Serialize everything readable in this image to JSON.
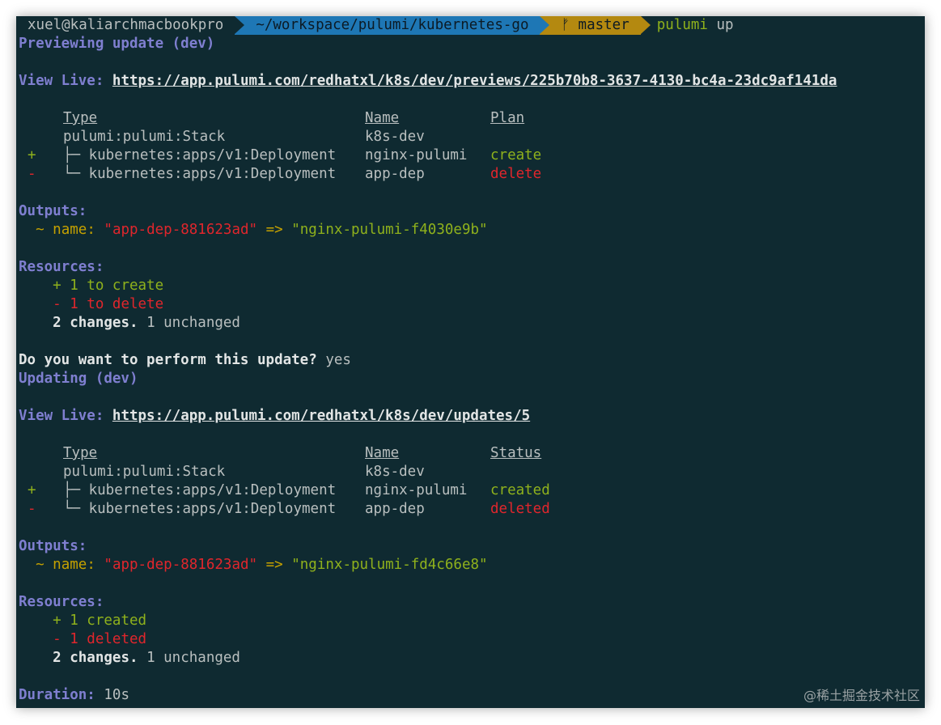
{
  "prompt": {
    "user": "xuel@kaliarchmacbookpro",
    "path": "~/workspace/pulumi/kubernetes-go",
    "branch_icon": "git-branch-icon",
    "branch_glyph": "ᚠ",
    "branch": "master",
    "command": "pulumi",
    "command_arg": "up"
  },
  "preview": {
    "title": "Previewing update (dev)",
    "view_live_label": "View Live:",
    "view_live_url": "https://app.pulumi.com/redhatxl/k8s/dev/previews/225b70b8-3637-4130-bc4a-23dc9af141da",
    "headers": {
      "type": "Type",
      "name": "Name",
      "plan": "Plan"
    },
    "rows": [
      {
        "op": "",
        "type": "pulumi:pulumi:Stack",
        "name": "k8s-dev",
        "plan": ""
      },
      {
        "op": "+",
        "type": "├─ kubernetes:apps/v1:Deployment",
        "name": "nginx-pulumi",
        "plan": "create"
      },
      {
        "op": "-",
        "type": "└─ kubernetes:apps/v1:Deployment",
        "name": "app-dep",
        "plan": "delete"
      }
    ],
    "outputs_label": "Outputs:",
    "output_tilde": "~",
    "output_key": "name:",
    "output_old": "\"app-dep-881623ad\"",
    "output_arrow": "=>",
    "output_new": "\"nginx-pulumi-f4030e9b\"",
    "resources_label": "Resources:",
    "res_create": "+ 1 to create",
    "res_delete": "- 1 to delete",
    "changes_bold": "2 changes.",
    "changes_rest": "1 unchanged"
  },
  "confirm": {
    "question": "Do you want to perform this update?",
    "answer": "yes"
  },
  "update": {
    "title": "Updating (dev)",
    "view_live_label": "View Live:",
    "view_live_url": "https://app.pulumi.com/redhatxl/k8s/dev/updates/5",
    "headers": {
      "type": "Type",
      "name": "Name",
      "status": "Status"
    },
    "rows": [
      {
        "op": "",
        "type": "pulumi:pulumi:Stack",
        "name": "k8s-dev",
        "status": ""
      },
      {
        "op": "+",
        "type": "├─ kubernetes:apps/v1:Deployment",
        "name": "nginx-pulumi",
        "status": "created"
      },
      {
        "op": "-",
        "type": "└─ kubernetes:apps/v1:Deployment",
        "name": "app-dep",
        "status": "deleted"
      }
    ],
    "outputs_label": "Outputs:",
    "output_tilde": "~",
    "output_key": "name:",
    "output_old": "\"app-dep-881623ad\"",
    "output_arrow": "=>",
    "output_new": "\"nginx-pulumi-fd4c66e8\"",
    "resources_label": "Resources:",
    "res_create": "+ 1 created",
    "res_delete": "- 1 deleted",
    "changes_bold": "2 changes.",
    "changes_rest": "1 unchanged",
    "duration_label": "Duration:",
    "duration_value": "10s"
  },
  "watermark": "@稀土掘金技术社区",
  "colors": {
    "background": "#0f2a31",
    "heading": "#7f7fd0",
    "create": "#8fb11c",
    "delete": "#e0262c",
    "key": "#c5a100",
    "path_segment": "#1e77b5",
    "branch_segment": "#b48910"
  }
}
